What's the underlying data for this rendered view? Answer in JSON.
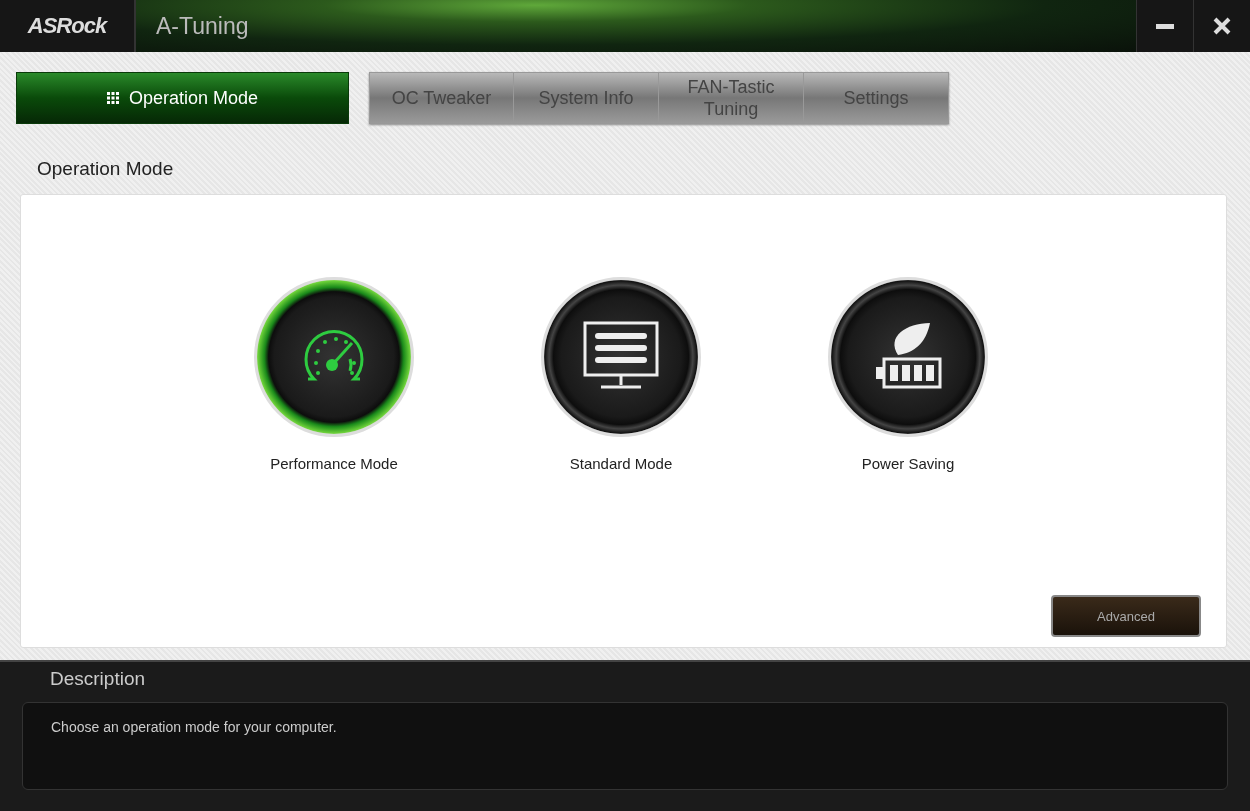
{
  "window": {
    "logo": "ASRock",
    "title": "A-Tuning"
  },
  "tabs": [
    {
      "label": "Operation Mode",
      "selected": true
    },
    {
      "label": "OC Tweaker",
      "selected": false
    },
    {
      "label": "System Info",
      "selected": false
    },
    {
      "label": "FAN-Tastic Tuning",
      "selected": false
    },
    {
      "label": "Settings",
      "selected": false
    }
  ],
  "section_title": "Operation Mode",
  "modes": [
    {
      "kind": "gauge",
      "label": "Performance Mode",
      "selected": true
    },
    {
      "kind": "monitor",
      "label": "Standard Mode",
      "selected": false
    },
    {
      "kind": "leaf-battery",
      "label": "Power Saving",
      "selected": false
    }
  ],
  "advanced_button": "Advanced",
  "description": {
    "title": "Description",
    "text": "Choose an operation mode for your computer."
  }
}
